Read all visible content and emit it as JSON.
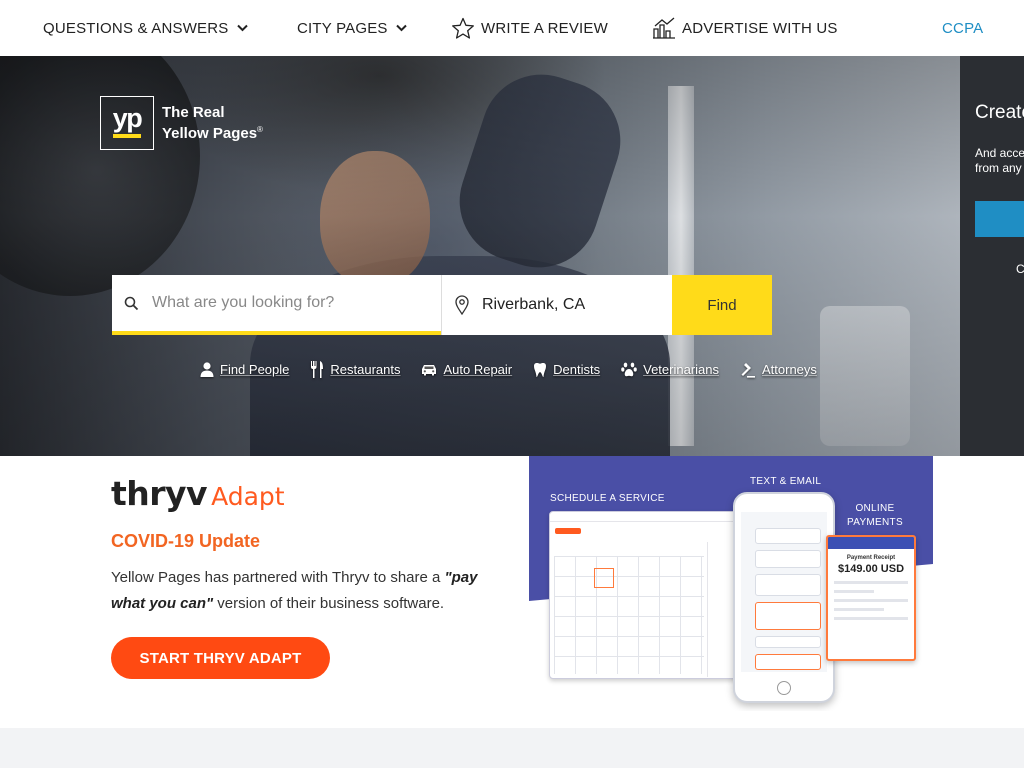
{
  "nav": {
    "questions_answers": "QUESTIONS & ANSWERS",
    "city_pages": "CITY PAGES",
    "write_review": "WRITE A REVIEW",
    "advertise": "ADVERTISE WITH US",
    "ccpa": "CCPA"
  },
  "brand": {
    "logo_mark": "yp",
    "tagline_line1": "The Real",
    "tagline_line2": "Yellow Pages",
    "registered": "®"
  },
  "search": {
    "what_placeholder": "What are you looking for?",
    "what_value": "",
    "where_value": "Riverbank, CA",
    "find_label": "Find"
  },
  "quick_links": [
    {
      "label": "Find People",
      "icon": "person-icon"
    },
    {
      "label": "Restaurants",
      "icon": "fork-knife-icon"
    },
    {
      "label": "Auto Repair",
      "icon": "car-icon"
    },
    {
      "label": "Dentists",
      "icon": "tooth-icon"
    },
    {
      "label": "Veterinarians",
      "icon": "paw-icon"
    },
    {
      "label": "Attorneys",
      "icon": "gavel-icon"
    }
  ],
  "side_panel": {
    "title": "Create",
    "desc_line1": "And acce",
    "desc_line2": "from any",
    "link_fragment": "C"
  },
  "thryv": {
    "logo_word": "thryv",
    "logo_adapt": "Adapt",
    "heading": "COVID-19 Update",
    "text_before": "Yellow Pages has partnered with Thryv to share a ",
    "text_bold": "\"pay what you can\"",
    "text_after": " version of their business software.",
    "button_label": "START THRYV ADAPT",
    "promo": {
      "label_schedule": "SCHEDULE A SERVICE",
      "label_text_email": "TEXT & EMAIL",
      "label_online_1": "ONLINE",
      "label_online_2": "PAYMENTS",
      "receipt_title": "Payment Receipt",
      "receipt_amount": "$149.00 USD"
    }
  },
  "colors": {
    "brand_yellow": "#ffdb19",
    "link_blue": "#1f8ec4",
    "thryv_orange": "#ff4a12",
    "promo_purple": "#4a4fa6"
  }
}
